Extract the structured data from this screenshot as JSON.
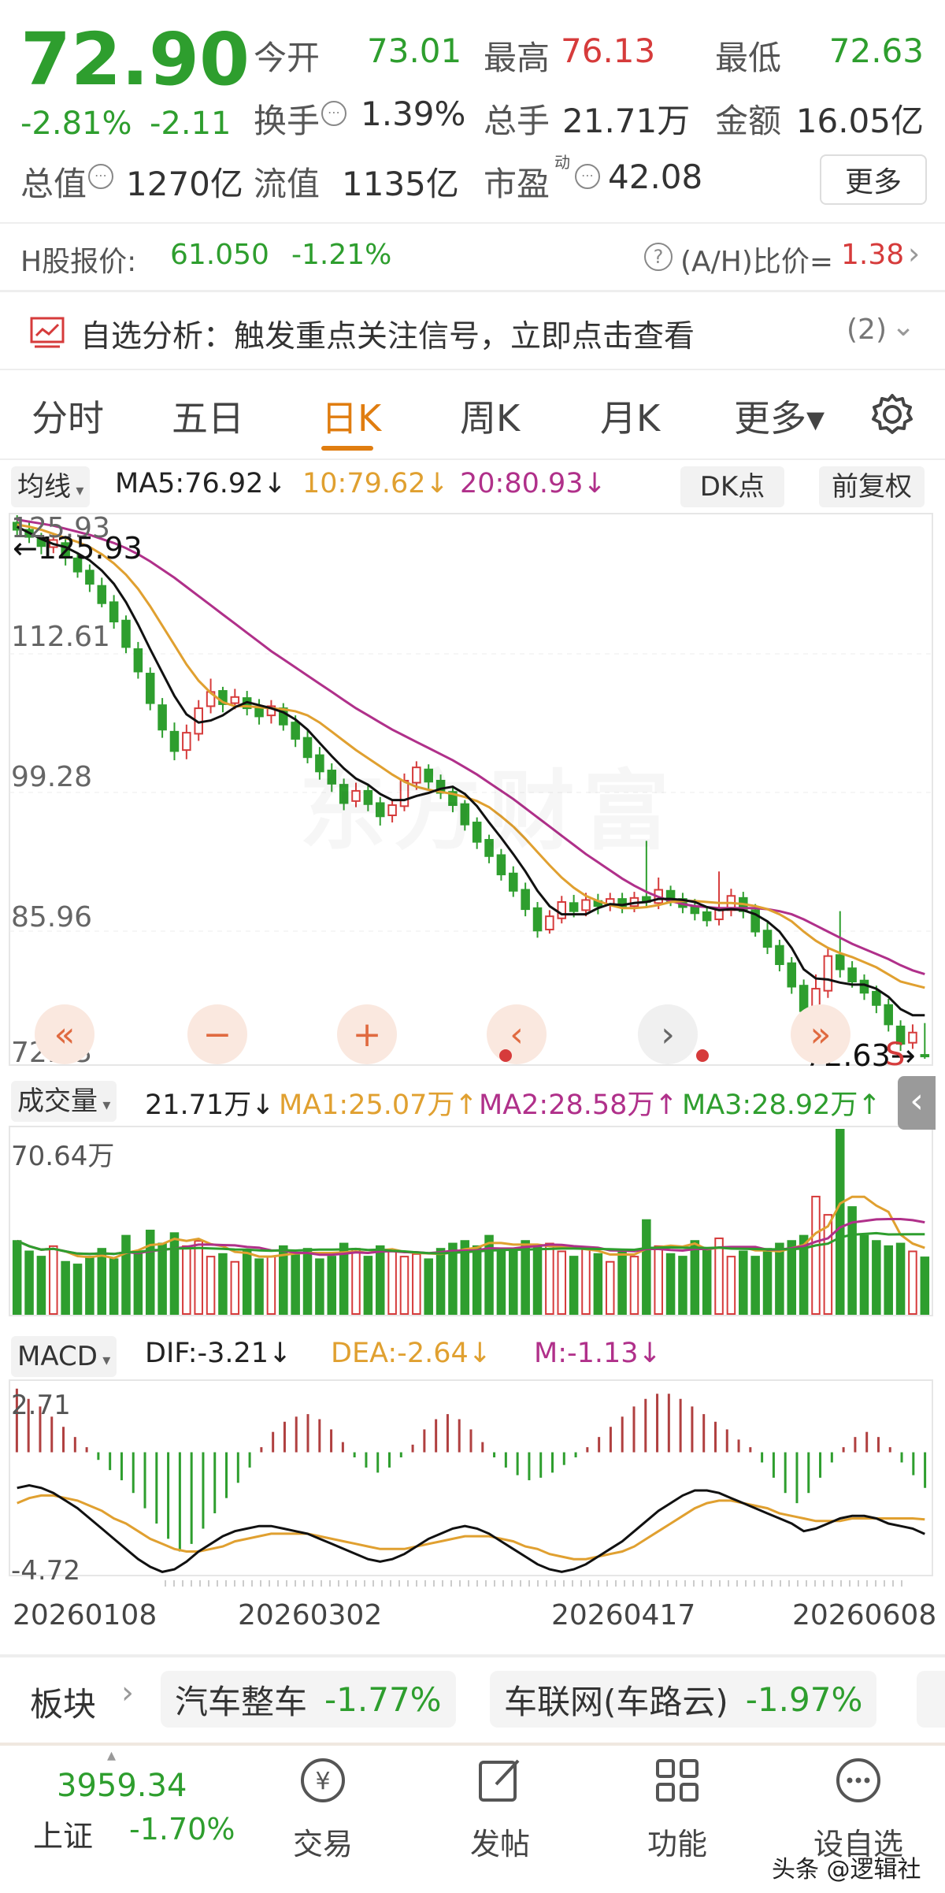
{
  "quote": {
    "price": "72.90",
    "change_pct": "-2.81%",
    "change": "-2.11",
    "stats": [
      {
        "label": "今开",
        "value": "73.01",
        "color": "#2e9e2e"
      },
      {
        "label": "最高",
        "value": "76.13",
        "color": "#d63b3b"
      },
      {
        "label": "最低",
        "value": "72.63",
        "color": "#2e9e2e"
      },
      {
        "label": "换手",
        "value": "1.39%",
        "color": "#333333"
      },
      {
        "label": "总手",
        "value": "21.71万",
        "color": "#333333"
      },
      {
        "label": "金额",
        "value": "16.05亿",
        "color": "#333333"
      },
      {
        "label": "总值",
        "value": "1270亿",
        "color": "#333333"
      },
      {
        "label": "流值",
        "value": "1135亿",
        "color": "#333333"
      },
      {
        "label": "市盈",
        "sup": "动",
        "value": "42.08",
        "color": "#333333"
      }
    ],
    "more_button": "更多"
  },
  "hshare": {
    "label": "H股报价:",
    "price": "61.050",
    "change_pct": "-1.21%",
    "ratio_label": "(A/H)比价=",
    "ratio_value": "1.38"
  },
  "banner": {
    "text": "自选分析：触发重点关注信号，立即点击查看",
    "count": "(2)"
  },
  "tabs": [
    {
      "label": "分时",
      "active": false
    },
    {
      "label": "五日",
      "active": false
    },
    {
      "label": "日K",
      "active": true
    },
    {
      "label": "周K",
      "active": false
    },
    {
      "label": "月K",
      "active": false
    },
    {
      "label": "更多▾",
      "active": false
    }
  ],
  "ma_bar": {
    "selector": "均线",
    "ma5": "MA5:76.92↓",
    "ma10": "10:79.62↓",
    "ma20": "20:80.93↓",
    "dk": "DK点",
    "adjust": "前复权"
  },
  "kline": {
    "axis": [
      "125.93",
      "112.61",
      "99.28",
      "85.96",
      "72.63"
    ],
    "high_label": "←125.93",
    "low_label": "72.63→",
    "watermark": "东方财富",
    "s_marker": "S"
  },
  "volume": {
    "selector": "成交量",
    "current": "21.71万↓",
    "ma1": "MA1:25.07万↑",
    "ma2": "MA2:28.58万↑",
    "ma3": "MA3:28.92万↑",
    "max": "70.64万"
  },
  "macd": {
    "selector": "MACD",
    "dif": "DIF:-3.21↓",
    "dea": "DEA:-2.64↓",
    "m": "M:-1.13↓",
    "top": "2.71",
    "bottom": "-4.72"
  },
  "dates": [
    "20260108",
    "20260302",
    "20260417",
    "20260608"
  ],
  "sectors": {
    "label": "板块",
    "items": [
      {
        "name": "汽车整车",
        "pct": "-1.77%"
      },
      {
        "name": "车联网(车路云)",
        "pct": "-1.97%"
      }
    ]
  },
  "bottom_nav": {
    "index_value": "3959.34",
    "index_name": "上证",
    "index_pct": "-1.70%",
    "items": [
      {
        "label": "交易",
        "icon": "trade-icon"
      },
      {
        "label": "发帖",
        "icon": "post-icon"
      },
      {
        "label": "功能",
        "icon": "apps-icon"
      },
      {
        "label": "设自选",
        "icon": "more-icon"
      }
    ]
  },
  "watermark_source": "头条 @逻辑社",
  "colors": {
    "up": "#d63b3b",
    "down": "#2e9e2e",
    "accent": "#e07d10",
    "ma10": "#e0a030",
    "ma20": "#b0308a"
  },
  "chart_data": {
    "type": "candlestick",
    "ylim": [
      72.63,
      125.93
    ],
    "candles": [
      [
        125.2,
        124.5,
        125.93,
        123.8
      ],
      [
        124.5,
        123.8,
        125.4,
        123.2
      ],
      [
        123.6,
        122.9,
        124.2,
        122.1
      ],
      [
        122.8,
        123.5,
        124.0,
        122.2
      ],
      [
        123.2,
        121.8,
        123.9,
        121.0
      ],
      [
        121.7,
        120.4,
        122.3,
        119.8
      ],
      [
        120.5,
        119.2,
        121.1,
        118.4
      ],
      [
        119.0,
        117.3,
        119.8,
        116.9
      ],
      [
        117.4,
        115.5,
        118.1,
        114.8
      ],
      [
        115.6,
        113.0,
        116.1,
        112.4
      ],
      [
        112.8,
        110.6,
        113.5,
        109.9
      ],
      [
        110.4,
        107.5,
        111.0,
        106.8
      ],
      [
        107.3,
        104.9,
        108.0,
        104.1
      ],
      [
        104.7,
        102.8,
        105.6,
        101.9
      ],
      [
        102.9,
        104.6,
        105.4,
        102.0
      ],
      [
        104.5,
        107.0,
        107.8,
        103.8
      ],
      [
        107.2,
        108.6,
        109.9,
        106.5
      ],
      [
        108.7,
        107.4,
        109.1,
        106.6
      ],
      [
        107.5,
        108.1,
        108.9,
        106.9
      ],
      [
        108.0,
        107.0,
        108.7,
        106.3
      ],
      [
        107.1,
        106.2,
        107.9,
        105.4
      ],
      [
        106.3,
        107.2,
        107.8,
        105.5
      ],
      [
        107.0,
        105.4,
        107.5,
        104.8
      ],
      [
        105.6,
        104.0,
        106.3,
        103.2
      ],
      [
        104.1,
        102.2,
        104.8,
        101.6
      ],
      [
        102.4,
        100.8,
        103.2,
        100.0
      ],
      [
        100.9,
        99.6,
        101.6,
        98.8
      ],
      [
        99.5,
        97.7,
        100.1,
        97.0
      ],
      [
        97.9,
        98.9,
        99.7,
        97.3
      ],
      [
        98.9,
        97.6,
        99.4,
        96.9
      ],
      [
        97.7,
        96.4,
        98.3,
        95.5
      ],
      [
        96.5,
        97.5,
        98.1,
        95.8
      ],
      [
        97.4,
        99.9,
        100.6,
        96.9
      ],
      [
        99.7,
        101.2,
        101.8,
        99.0
      ],
      [
        101.0,
        99.8,
        101.5,
        99.1
      ],
      [
        99.9,
        98.7,
        100.5,
        98.1
      ],
      [
        98.8,
        97.5,
        99.4,
        96.8
      ],
      [
        97.6,
        95.6,
        98.0,
        95.0
      ],
      [
        95.8,
        93.9,
        96.3,
        93.2
      ],
      [
        94.1,
        92.5,
        94.6,
        91.8
      ],
      [
        92.6,
        90.7,
        93.2,
        90.1
      ],
      [
        90.8,
        89.1,
        91.5,
        88.5
      ],
      [
        89.2,
        87.3,
        89.9,
        86.6
      ],
      [
        87.4,
        85.2,
        88.0,
        84.5
      ],
      [
        85.3,
        86.6,
        87.2,
        84.9
      ],
      [
        86.4,
        88.0,
        88.6,
        85.9
      ],
      [
        87.9,
        87.1,
        88.7,
        86.5
      ],
      [
        87.2,
        88.2,
        88.9,
        86.6
      ],
      [
        88.1,
        87.6,
        88.8,
        86.8
      ],
      [
        87.7,
        88.3,
        88.9,
        87.1
      ],
      [
        88.3,
        87.5,
        88.9,
        86.9
      ],
      [
        87.6,
        88.4,
        89.0,
        87.0
      ],
      [
        88.5,
        88.0,
        94.0,
        87.4
      ],
      [
        87.9,
        89.2,
        90.4,
        87.3
      ],
      [
        89.1,
        88.1,
        89.6,
        87.6
      ],
      [
        88.3,
        87.5,
        88.9,
        86.9
      ],
      [
        87.6,
        86.9,
        88.3,
        86.2
      ],
      [
        87.0,
        86.2,
        87.6,
        85.6
      ],
      [
        86.3,
        87.3,
        91.0,
        85.7
      ],
      [
        87.2,
        88.6,
        89.3,
        86.6
      ],
      [
        88.4,
        87.1,
        89.0,
        86.4
      ],
      [
        87.2,
        85.1,
        87.8,
        84.6
      ],
      [
        85.2,
        83.6,
        86.0,
        82.9
      ],
      [
        83.7,
        81.9,
        84.3,
        81.2
      ],
      [
        82.0,
        79.7,
        82.6,
        79.0
      ],
      [
        79.8,
        77.3,
        80.4,
        76.6
      ],
      [
        77.4,
        79.5,
        80.9,
        76.8
      ],
      [
        79.3,
        82.7,
        83.6,
        78.6
      ],
      [
        82.8,
        81.4,
        87.1,
        80.6
      ],
      [
        81.5,
        80.2,
        82.2,
        79.6
      ],
      [
        80.3,
        79.1,
        80.9,
        78.4
      ],
      [
        79.2,
        77.9,
        79.8,
        77.1
      ],
      [
        77.9,
        76.0,
        78.5,
        75.3
      ],
      [
        75.8,
        74.1,
        76.4,
        73.4
      ],
      [
        74.2,
        75.2,
        76.0,
        73.6
      ],
      [
        73.01,
        72.9,
        76.13,
        72.63
      ]
    ],
    "ma5": [
      124.8,
      124.2,
      123.6,
      123.1,
      122.8,
      122.2,
      121.5,
      120.5,
      119.2,
      117.4,
      115.2,
      112.8,
      110.5,
      108.2,
      106.4,
      105.6,
      105.8,
      106.3,
      107.1,
      107.6,
      107.3,
      107.0,
      106.6,
      105.9,
      104.9,
      103.6,
      102.3,
      101.1,
      100.1,
      99.5,
      98.6,
      98.0,
      98.0,
      98.4,
      98.7,
      99.1,
      99.3,
      98.6,
      97.4,
      95.8,
      94.3,
      92.7,
      91.0,
      89.1,
      87.6,
      86.8,
      86.8,
      86.8,
      87.4,
      87.8,
      87.7,
      87.9,
      88.0,
      88.3,
      88.3,
      88.2,
      88.0,
      87.5,
      87.2,
      87.3,
      87.2,
      86.8,
      86.1,
      85.1,
      83.5,
      81.4,
      80.5,
      80.4,
      80.1,
      79.9,
      79.9,
      79.5,
      78.7,
      77.5,
      76.9,
      76.9
    ],
    "ma10": [
      125.0,
      124.8,
      124.5,
      124.1,
      123.7,
      123.3,
      122.8,
      122.1,
      121.2,
      120.1,
      118.7,
      117.0,
      115.1,
      113.2,
      111.3,
      109.7,
      108.5,
      107.6,
      107.2,
      107.2,
      107.1,
      107.0,
      106.9,
      106.7,
      106.3,
      105.6,
      104.7,
      103.8,
      102.9,
      102.1,
      101.3,
      100.5,
      99.8,
      99.3,
      99.0,
      98.8,
      98.6,
      98.3,
      97.9,
      97.3,
      96.4,
      95.4,
      94.2,
      92.9,
      91.6,
      90.4,
      89.4,
      88.6,
      88.1,
      87.7,
      87.4,
      87.4,
      87.5,
      87.7,
      88.0,
      88.1,
      88.1,
      88.0,
      87.9,
      87.9,
      87.8,
      87.6,
      87.3,
      86.8,
      86.1,
      85.1,
      84.2,
      83.5,
      83.0,
      82.6,
      82.1,
      81.6,
      80.9,
      80.2,
      79.9,
      79.6
    ],
    "ma20": [
      125.5,
      125.3,
      125.1,
      124.9,
      124.6,
      124.3,
      124.0,
      123.6,
      123.2,
      122.7,
      122.1,
      121.4,
      120.6,
      119.8,
      118.9,
      118.0,
      117.1,
      116.2,
      115.3,
      114.4,
      113.5,
      112.6,
      111.8,
      111.0,
      110.2,
      109.4,
      108.6,
      107.8,
      107.0,
      106.3,
      105.6,
      104.9,
      104.3,
      103.7,
      103.1,
      102.5,
      101.9,
      101.2,
      100.5,
      99.7,
      98.9,
      98.1,
      97.2,
      96.3,
      95.4,
      94.5,
      93.6,
      92.7,
      91.9,
      91.1,
      90.3,
      89.6,
      89.0,
      88.5,
      88.1,
      87.8,
      87.6,
      87.5,
      87.4,
      87.4,
      87.4,
      87.4,
      87.3,
      87.1,
      86.8,
      86.3,
      85.7,
      85.1,
      84.5,
      83.9,
      83.4,
      82.9,
      82.4,
      81.8,
      81.3,
      80.93
    ],
    "volume_max": 70.64,
    "volumes": [
      28,
      24,
      22,
      26,
      20,
      19,
      22,
      25,
      21,
      30,
      24,
      32,
      27,
      31,
      26,
      28,
      22,
      23,
      20,
      24,
      21,
      22,
      26,
      23,
      25,
      21,
      22,
      27,
      25,
      22,
      26,
      24,
      22,
      23,
      21,
      25,
      27,
      28,
      26,
      30,
      25,
      24,
      28,
      26,
      27,
      24,
      22,
      25,
      23,
      20,
      24,
      22,
      36,
      26,
      23,
      22,
      28,
      25,
      29,
      22,
      24,
      22,
      25,
      27,
      28,
      30,
      45,
      38,
      70.64,
      41,
      30,
      28,
      26,
      27,
      24,
      21.71
    ],
    "macd_range": [
      -4.72,
      2.71
    ],
    "macd_hist": [
      2.5,
      2.1,
      1.8,
      1.4,
      1.0,
      0.6,
      0.2,
      -0.3,
      -0.7,
      -1.1,
      -1.6,
      -2.2,
      -2.8,
      -3.4,
      -3.9,
      -3.6,
      -3.0,
      -2.4,
      -1.8,
      -1.2,
      -0.6,
      0.2,
      0.8,
      1.2,
      1.4,
      1.5,
      1.3,
      0.9,
      0.4,
      -0.2,
      -0.6,
      -0.8,
      -0.6,
      -0.2,
      0.3,
      0.9,
      1.3,
      1.5,
      1.3,
      0.9,
      0.4,
      -0.2,
      -0.6,
      -0.9,
      -1.1,
      -1.0,
      -0.8,
      -0.5,
      -0.2,
      0.2,
      0.6,
      1.0,
      1.4,
      1.8,
      2.1,
      2.3,
      2.3,
      2.1,
      1.8,
      1.5,
      1.2,
      0.9,
      0.5,
      0.2,
      -0.4,
      -1.0,
      -1.6,
      -2.0,
      -1.6,
      -1.0,
      -0.4,
      0.2,
      0.6,
      0.8,
      0.6,
      0.2,
      -0.4,
      -0.9,
      -1.4
    ],
    "macd_dif": [
      -1.4,
      -1.3,
      -1.4,
      -1.6,
      -1.9,
      -2.2,
      -2.6,
      -3.0,
      -3.4,
      -3.8,
      -4.2,
      -4.5,
      -4.7,
      -4.6,
      -4.3,
      -3.9,
      -3.6,
      -3.3,
      -3.1,
      -3.0,
      -2.9,
      -2.9,
      -3.0,
      -3.1,
      -3.2,
      -3.4,
      -3.6,
      -3.8,
      -4.0,
      -4.2,
      -4.3,
      -4.2,
      -4.0,
      -3.7,
      -3.4,
      -3.2,
      -3.0,
      -2.9,
      -3.0,
      -3.2,
      -3.5,
      -3.8,
      -4.1,
      -4.4,
      -4.6,
      -4.7,
      -4.6,
      -4.4,
      -4.1,
      -3.8,
      -3.5,
      -3.1,
      -2.7,
      -2.3,
      -2.0,
      -1.7,
      -1.5,
      -1.5,
      -1.6,
      -1.8,
      -2.0,
      -2.2,
      -2.4,
      -2.6,
      -2.8,
      -3.1,
      -3.0,
      -2.8,
      -2.6,
      -2.5,
      -2.5,
      -2.6,
      -2.8,
      -2.9,
      -3.0,
      -3.21
    ],
    "macd_dea": [
      -2.0,
      -1.8,
      -1.7,
      -1.7,
      -1.8,
      -1.9,
      -2.1,
      -2.3,
      -2.6,
      -2.8,
      -3.1,
      -3.4,
      -3.6,
      -3.8,
      -3.9,
      -3.9,
      -3.8,
      -3.7,
      -3.5,
      -3.4,
      -3.3,
      -3.2,
      -3.2,
      -3.2,
      -3.2,
      -3.3,
      -3.4,
      -3.5,
      -3.6,
      -3.7,
      -3.8,
      -3.8,
      -3.8,
      -3.7,
      -3.6,
      -3.5,
      -3.4,
      -3.3,
      -3.3,
      -3.3,
      -3.4,
      -3.5,
      -3.7,
      -3.8,
      -4.0,
      -4.1,
      -4.2,
      -4.2,
      -4.1,
      -4.0,
      -3.9,
      -3.7,
      -3.4,
      -3.1,
      -2.8,
      -2.5,
      -2.2,
      -2.0,
      -1.9,
      -1.9,
      -2.0,
      -2.1,
      -2.2,
      -2.4,
      -2.5,
      -2.6,
      -2.7,
      -2.7,
      -2.7,
      -2.6,
      -2.6,
      -2.6,
      -2.6,
      -2.6,
      -2.6,
      -2.64
    ]
  }
}
